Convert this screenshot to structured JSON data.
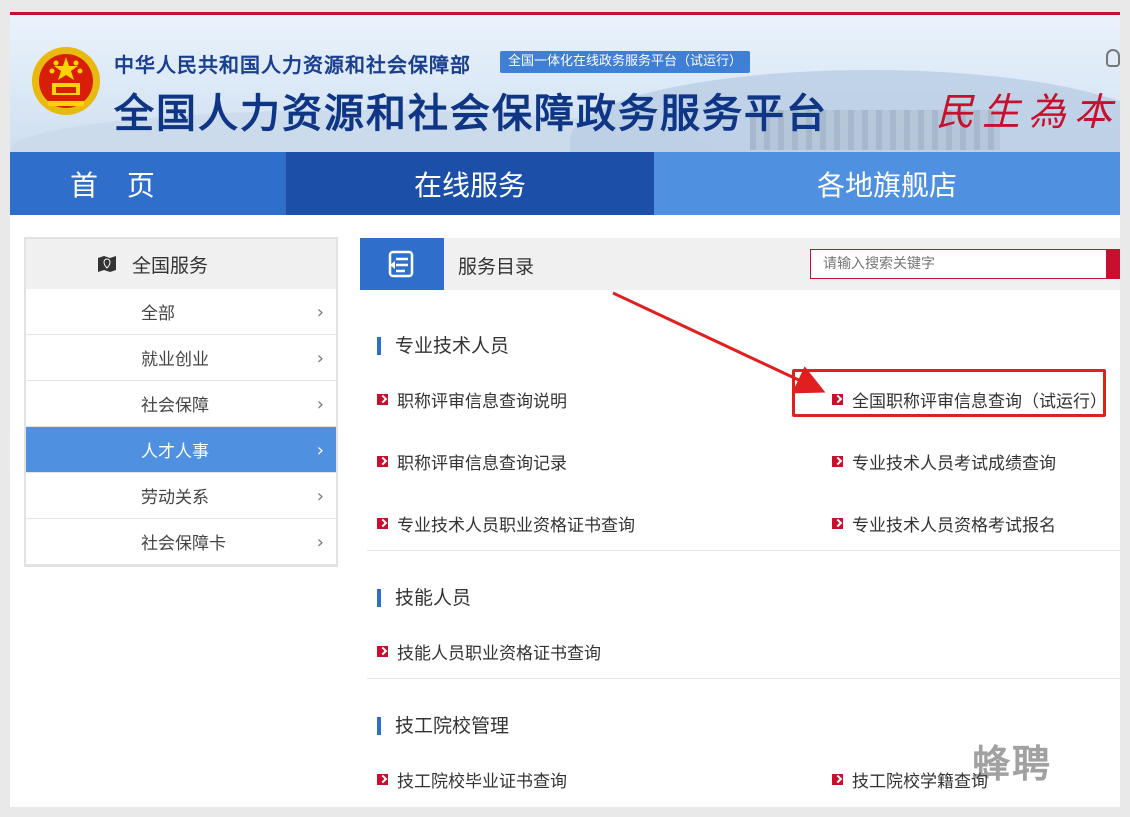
{
  "header": {
    "ministry": "中华人民共和国人力资源和社会保障部",
    "badge": "全国一体化在线政务服务平台（试运行）",
    "site_title": "全国人力资源和社会保障政务服务平台",
    "slogan": "民生為本"
  },
  "nav": {
    "home": "首 页",
    "online": "在线服务",
    "local": "各地旗舰店"
  },
  "sidebar": {
    "heading": "全国服务",
    "items": [
      {
        "label": "全部"
      },
      {
        "label": "就业创业"
      },
      {
        "label": "社会保障"
      },
      {
        "label": "人才人事",
        "active": true
      },
      {
        "label": "劳动关系"
      },
      {
        "label": "社会保障卡"
      }
    ]
  },
  "panel": {
    "title": "服务目录",
    "search_placeholder": "请输入搜索关键字"
  },
  "sections": [
    {
      "title": "专业技术人员",
      "links": [
        "职称评审信息查询说明",
        "全国职称评审信息查询（试运行）",
        "职称评审信息查询记录",
        "专业技术人员考试成绩查询",
        "专业技术人员职业资格证书查询",
        "专业技术人员资格考试报名"
      ]
    },
    {
      "title": "技能人员",
      "links": [
        "技能人员职业资格证书查询"
      ]
    },
    {
      "title": "技工院校管理",
      "links": [
        "技工院校毕业证书查询",
        "技工院校学籍查询"
      ]
    }
  ],
  "watermark": "蜂聘",
  "colors": {
    "brand_blue": "#2f6fcb",
    "nav_dark": "#1b4fa8",
    "accent_red": "#c8102e"
  }
}
